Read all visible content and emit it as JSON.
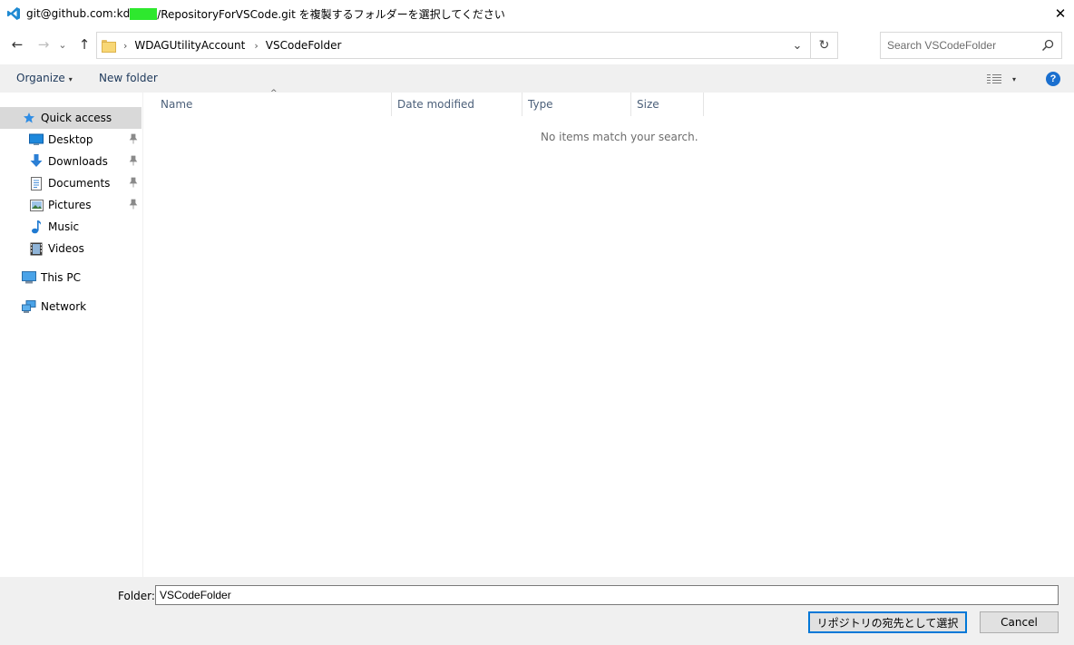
{
  "window": {
    "title_prefix": "git@github.com:kd",
    "title_suffix": "/RepositoryForVSCode.git を複製するフォルダーを選択してください",
    "close_glyph": "✕",
    "app_icon": "vscode-icon",
    "redaction_color": "#2ee82e"
  },
  "nav": {
    "back_glyph": "←",
    "forward_glyph": "→",
    "recent_glyph": "⌄",
    "up_glyph": "↑",
    "breadcrumbs": [
      "WDAGUtilityAccount",
      "VSCodeFolder"
    ],
    "crumb_separator": "›",
    "dropdown_glyph": "⌄",
    "refresh_glyph": "↻",
    "search_placeholder": "Search VSCodeFolder"
  },
  "commands": {
    "organize": "Organize",
    "new_folder": "New folder",
    "caret": "▾",
    "help": "?"
  },
  "sidebar": {
    "items": [
      {
        "label": "Quick access",
        "icon": "star-icon"
      },
      {
        "label": "Desktop",
        "icon": "desktop-icon",
        "pinned": true
      },
      {
        "label": "Downloads",
        "icon": "download-icon",
        "pinned": true
      },
      {
        "label": "Documents",
        "icon": "document-icon",
        "pinned": true
      },
      {
        "label": "Pictures",
        "icon": "pictures-icon",
        "pinned": true
      },
      {
        "label": "Music",
        "icon": "music-icon"
      },
      {
        "label": "Videos",
        "icon": "video-icon"
      },
      {
        "label": "This PC",
        "icon": "computer-icon"
      },
      {
        "label": "Network",
        "icon": "network-icon"
      }
    ],
    "pin_glyph": "📌"
  },
  "content": {
    "columns": [
      "Name",
      "Date modified",
      "Type",
      "Size"
    ],
    "sort_glyph": "^",
    "empty_message": "No items match your search."
  },
  "footer": {
    "folder_label": "Folder:",
    "folder_value": "VSCodeFolder",
    "select_button": "リポジトリの宛先として選択",
    "cancel_button": "Cancel"
  },
  "colors": {
    "accent": "#0078d7",
    "selected": "#d9d9d9",
    "bar_bg": "#f0f0f0",
    "header_text": "#4c607a",
    "help_blue": "#1a6fcf"
  }
}
